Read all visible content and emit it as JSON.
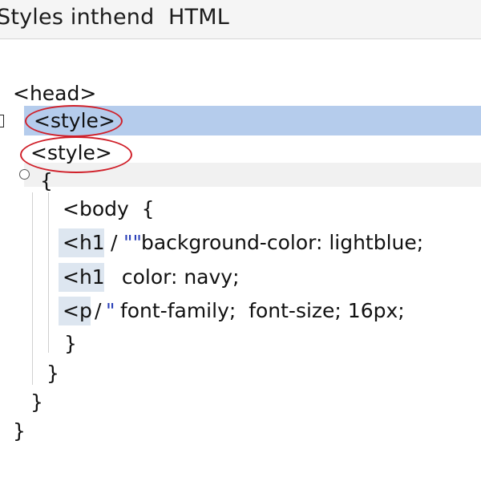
{
  "window": {
    "title": "Styles inthend  HTML"
  },
  "editor": {
    "lines": [
      "<head>",
      "<style>",
      "<style>",
      "{",
      "<body  {",
      "<h1",
      " /",
      "\"\"",
      " background-color: lightblue;",
      "<h1",
      "   color: navy;",
      "<p",
      " /",
      "\"",
      " font-family;  font-size; 16px;",
      "}",
      "}",
      "}",
      "}"
    ]
  },
  "colors": {
    "selection_highlight": "#b5ccec",
    "annotation_circle": "#d0202a",
    "quote_blue": "#2a3fb8"
  }
}
